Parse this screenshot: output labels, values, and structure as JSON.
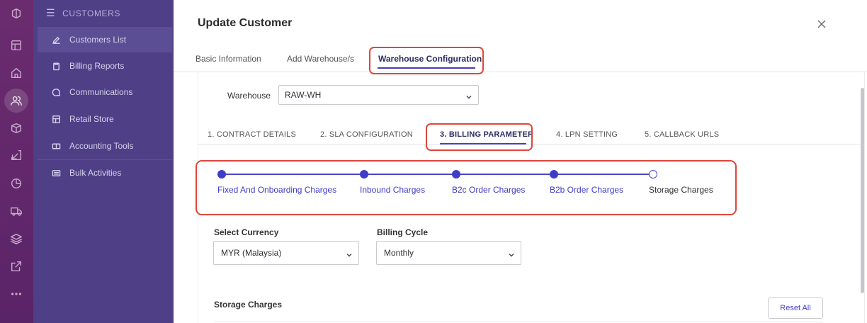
{
  "sidebar": {
    "section_title": "CUSTOMERS",
    "items": [
      {
        "label": "Customers List",
        "icon": "pencil-icon"
      },
      {
        "label": "Billing Reports",
        "icon": "clipboard-icon"
      },
      {
        "label": "Communications",
        "icon": "chat-bubble-icon"
      },
      {
        "label": "Retail Store",
        "icon": "store-icon"
      },
      {
        "label": "Accounting Tools",
        "icon": "ledger-icon"
      },
      {
        "label": "Bulk Activities",
        "icon": "bulk-icon"
      }
    ],
    "active_item": "Customers List"
  },
  "rail_icons": [
    "logo-icon",
    "layout-icon",
    "home-icon",
    "users-icon",
    "box-icon",
    "inbound-arrow-icon",
    "pie-chart-icon",
    "truck-icon",
    "layers-icon",
    "external-link-icon",
    "more-dots-icon"
  ],
  "modal": {
    "title": "Update Customer",
    "close_icon": "close-icon",
    "tabs": [
      {
        "label": "Basic Information"
      },
      {
        "label": "Add Warehouse/s"
      },
      {
        "label": "Warehouse Configuration"
      }
    ],
    "active_tab": "Warehouse Configuration"
  },
  "warehouse": {
    "label": "Warehouse",
    "value": "RAW-WH"
  },
  "sub_tabs": [
    {
      "label": "1. CONTRACT DETAILS"
    },
    {
      "label": "2. SLA CONFIGURATION"
    },
    {
      "label": "3. BILLING PARAMETER"
    },
    {
      "label": "4. LPN SETTING"
    },
    {
      "label": "5. CALLBACK URLS"
    }
  ],
  "active_sub_tab": "3. BILLING PARAMETER",
  "steps": [
    {
      "label": "Fixed And Onboarding Charges",
      "done": true
    },
    {
      "label": "Inbound Charges",
      "done": true
    },
    {
      "label": "B2c Order Charges",
      "done": true
    },
    {
      "label": "B2b Order Charges",
      "done": true
    },
    {
      "label": "Storage Charges",
      "done": false
    }
  ],
  "form": {
    "currency_label": "Select Currency",
    "currency_value": "MYR (Malaysia)",
    "billing_cycle_label": "Billing Cycle",
    "billing_cycle_value": "Monthly"
  },
  "storage": {
    "section_title": "Storage Charges",
    "reset_label": "Reset All"
  },
  "colors": {
    "accent": "#3f3cc7",
    "highlight": "#e0463a",
    "sidebar_bg": "#4e3f86",
    "rail_bg": "#6b2c6e"
  }
}
